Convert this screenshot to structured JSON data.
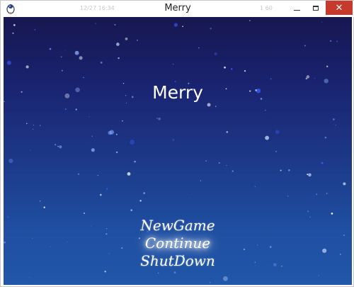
{
  "window": {
    "title": "Merry",
    "ghost_left": "12/27 16:34",
    "ghost_right": "1 60",
    "app_icon": "penguin-icon",
    "buttons": {
      "minimize": "minimize-icon",
      "maximize": "maximize-icon",
      "close": "close-icon",
      "close_glyph": "✕"
    }
  },
  "game": {
    "title": "Merry",
    "menu": [
      {
        "label": "NewGame",
        "selected": false
      },
      {
        "label": "Continue",
        "selected": true
      },
      {
        "label": "ShutDown",
        "selected": false
      }
    ]
  },
  "colors": {
    "sky_top": "#171750",
    "sky_bottom": "#2156a8",
    "close_button": "#c7392a",
    "text": "#ffffff"
  }
}
